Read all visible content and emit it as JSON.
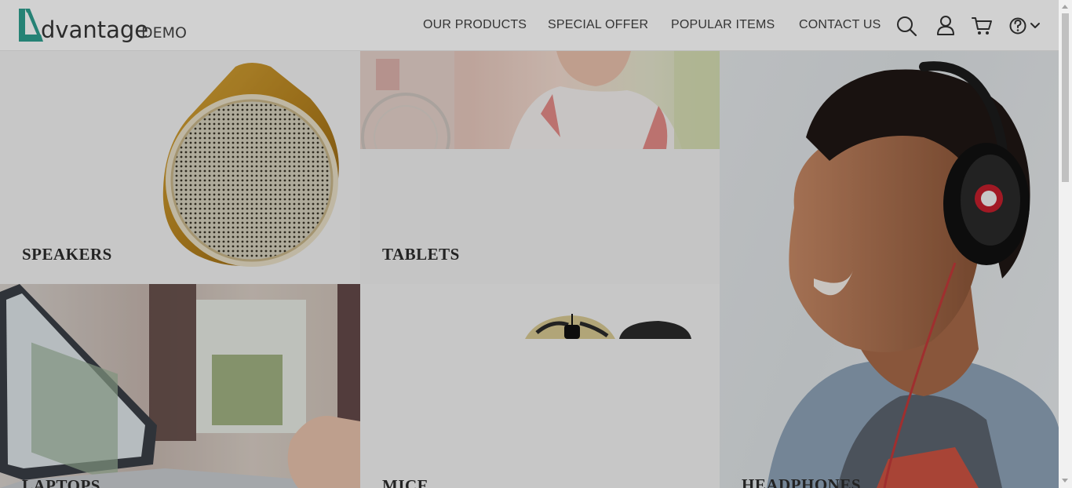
{
  "brand": {
    "name": "dvantage",
    "suffix": "DEMO",
    "colors": {
      "accent": "#2f9f8f",
      "text": "#363636"
    }
  },
  "nav": {
    "items": [
      {
        "label": "OUR PRODUCTS"
      },
      {
        "label": "SPECIAL OFFER"
      },
      {
        "label": "POPULAR ITEMS"
      },
      {
        "label": "CONTACT US"
      }
    ]
  },
  "header_icons": [
    "search-icon",
    "user-icon",
    "cart-icon",
    "help-icon",
    "chevron-down-icon"
  ],
  "categories": [
    {
      "label": "SPEAKERS"
    },
    {
      "label": "TABLETS"
    },
    {
      "label": "HEADPHONES"
    },
    {
      "label": "LAPTOPS"
    },
    {
      "label": "MICE"
    }
  ]
}
